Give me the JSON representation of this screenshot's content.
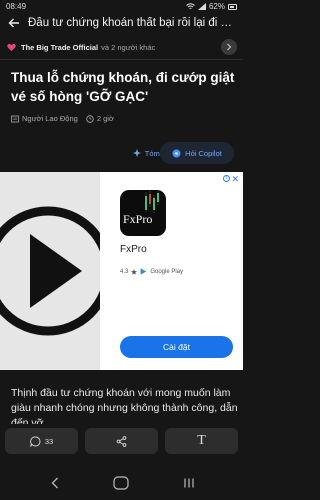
{
  "status": {
    "time": "08:49",
    "battery": "62%"
  },
  "header": {
    "title": "Đầu tư chứng khoán thất bại rồi lại đi cướp giật"
  },
  "source": {
    "name": "The Big Trade Official",
    "others": "và 2 người khác"
  },
  "article": {
    "headline": "Thua lỗ chứng khoán, đi cướp giật vé số hòng 'GỠ GẠC'",
    "publisher": "Người Lao Động",
    "time_ago": "2 giờ",
    "summary_label": "Tóm tắt",
    "copilot_label": "Hỏi Copilot",
    "body": "Thịnh đầu tư chứng khoán với mong muốn làm giàu nhanh chóng nhưng không thành công, dẫn đến vỡ"
  },
  "ad": {
    "brand_text": "FxPro",
    "app_name": "FxPro",
    "rating": "4.3",
    "store_label": "Google Play",
    "install_label": "Cài đặt"
  },
  "toolbar": {
    "comments_count": "33"
  },
  "colors": {
    "accent": "#1a73e8",
    "heart": "#e8457a",
    "link": "#6fa8ff"
  }
}
